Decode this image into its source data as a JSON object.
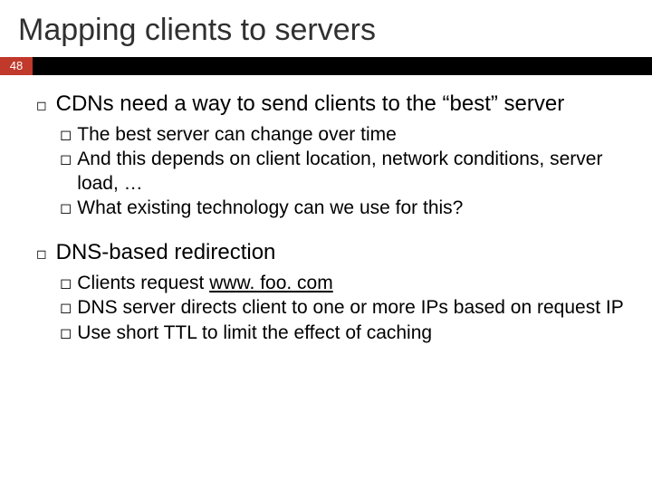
{
  "title": "Mapping clients to servers",
  "page_number": "48",
  "items": [
    {
      "text": "CDNs need a way to send clients to the “best” server",
      "sub": [
        {
          "text": "The best server can change over time"
        },
        {
          "text": "And this depends on client location, network conditions, server load, …"
        },
        {
          "text": "What existing technology can we use for this?"
        }
      ]
    },
    {
      "text": "DNS-based redirection",
      "sub": [
        {
          "prefix": "Clients request ",
          "link": "www. foo. com"
        },
        {
          "text": "DNS server directs client to one or more IPs based on request IP"
        },
        {
          "text": "Use short TTL to limit the effect of caching"
        }
      ]
    }
  ]
}
